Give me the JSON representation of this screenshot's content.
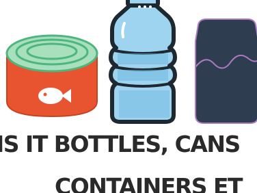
{
  "headline": {
    "line1": "IS IT BOTTLES,  CANS",
    "line2": "CONTAINERS ET"
  },
  "icons": {
    "can": "food-can-icon",
    "bottle": "water-bottle-icon",
    "soda_can": "soda-can-icon"
  },
  "colors": {
    "can_body": "#E8542F",
    "can_lid": "#A8E0BE",
    "can_lid_ring": "#4DB67E",
    "bottle_fill": "#9ED4F0",
    "bottle_dark": "#1E2830",
    "soda_can_body": "#2E3E50",
    "soda_can_wave": "#B07AC0",
    "text": "#2A2A2A"
  }
}
